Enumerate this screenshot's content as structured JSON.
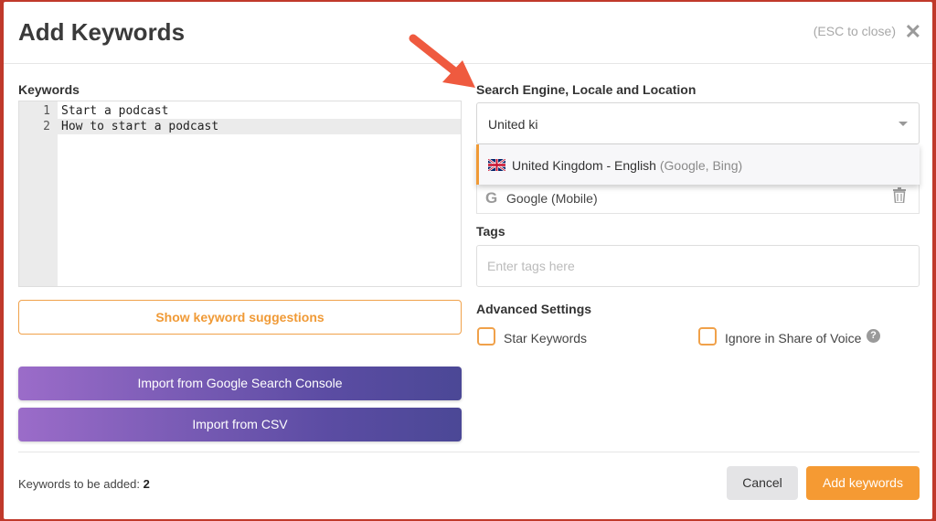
{
  "header": {
    "title": "Add Keywords",
    "esc_hint": "(ESC to close)"
  },
  "keywords": {
    "label": "Keywords",
    "lines": [
      {
        "num": "1",
        "text": "Start a podcast"
      },
      {
        "num": "2",
        "text": "How to start a podcast"
      }
    ],
    "suggest_button": "Show keyword suggestions",
    "import_gsc_button": "Import from Google Search Console",
    "import_csv_button": "Import from CSV"
  },
  "search_engine": {
    "label": "Search Engine, Locale and Location",
    "input_value": "United ki",
    "dropdown_option": {
      "main": "United Kingdom - English",
      "sub": "(Google, Bing)"
    },
    "engine_row": "Google (Mobile)"
  },
  "tags": {
    "label": "Tags",
    "placeholder": "Enter tags here"
  },
  "advanced": {
    "label": "Advanced Settings",
    "star_label": "Star Keywords",
    "ignore_label": "Ignore in Share of Voice",
    "help_glyph": "?"
  },
  "footer": {
    "count_label": "Keywords to be added:",
    "count_value": "2",
    "cancel_button": "Cancel",
    "add_button": "Add keywords"
  },
  "colors": {
    "accent": "#f59a33",
    "arrow": "#ef5a3f",
    "gradient_start": "#9b6cc9",
    "gradient_end": "#4b4896"
  },
  "icons": [
    "close-icon",
    "caret-down-icon",
    "uk-flag-icon",
    "google-icon",
    "trash-icon",
    "help-icon",
    "annotation-arrow-icon"
  ]
}
